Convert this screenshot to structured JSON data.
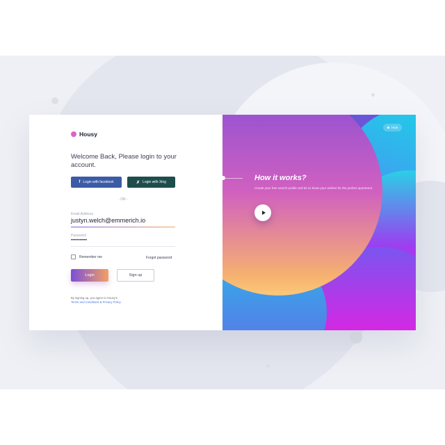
{
  "brand": {
    "name": "Housy"
  },
  "login": {
    "welcome": "Welcome Back, Please login to your account.",
    "facebook_label": "Login with facebook",
    "xing_label": "Login with Xing",
    "or_label": "- OR -",
    "email_label": "Email Address",
    "email_value": "justyn.welch@emmerich.io",
    "password_label": "Password",
    "password_value": "•••••••••••",
    "remember_label": "Remember me",
    "forgot_label": "Forgot password",
    "login_button": "Login",
    "signup_button": "Sign up",
    "terms_prefix": "By signing up, you agree to Housy's",
    "terms_link": "Terms and Conditions",
    "terms_and": " & ",
    "privacy_link": "Privacy Policy"
  },
  "promo": {
    "hide_label": "Hide",
    "title": "How it works?",
    "description": "Create your free search profile and let us know your wishes for the perfect apartment."
  },
  "colors": {
    "accent_purple": "#7b4fd8",
    "accent_orange": "#f2a063",
    "facebook": "#3b5ba6",
    "xing": "#1e4d4d",
    "link": "#4a7be0"
  },
  "icons": [
    "facebook-icon",
    "xing-icon",
    "play-icon",
    "housy-logo-icon"
  ]
}
